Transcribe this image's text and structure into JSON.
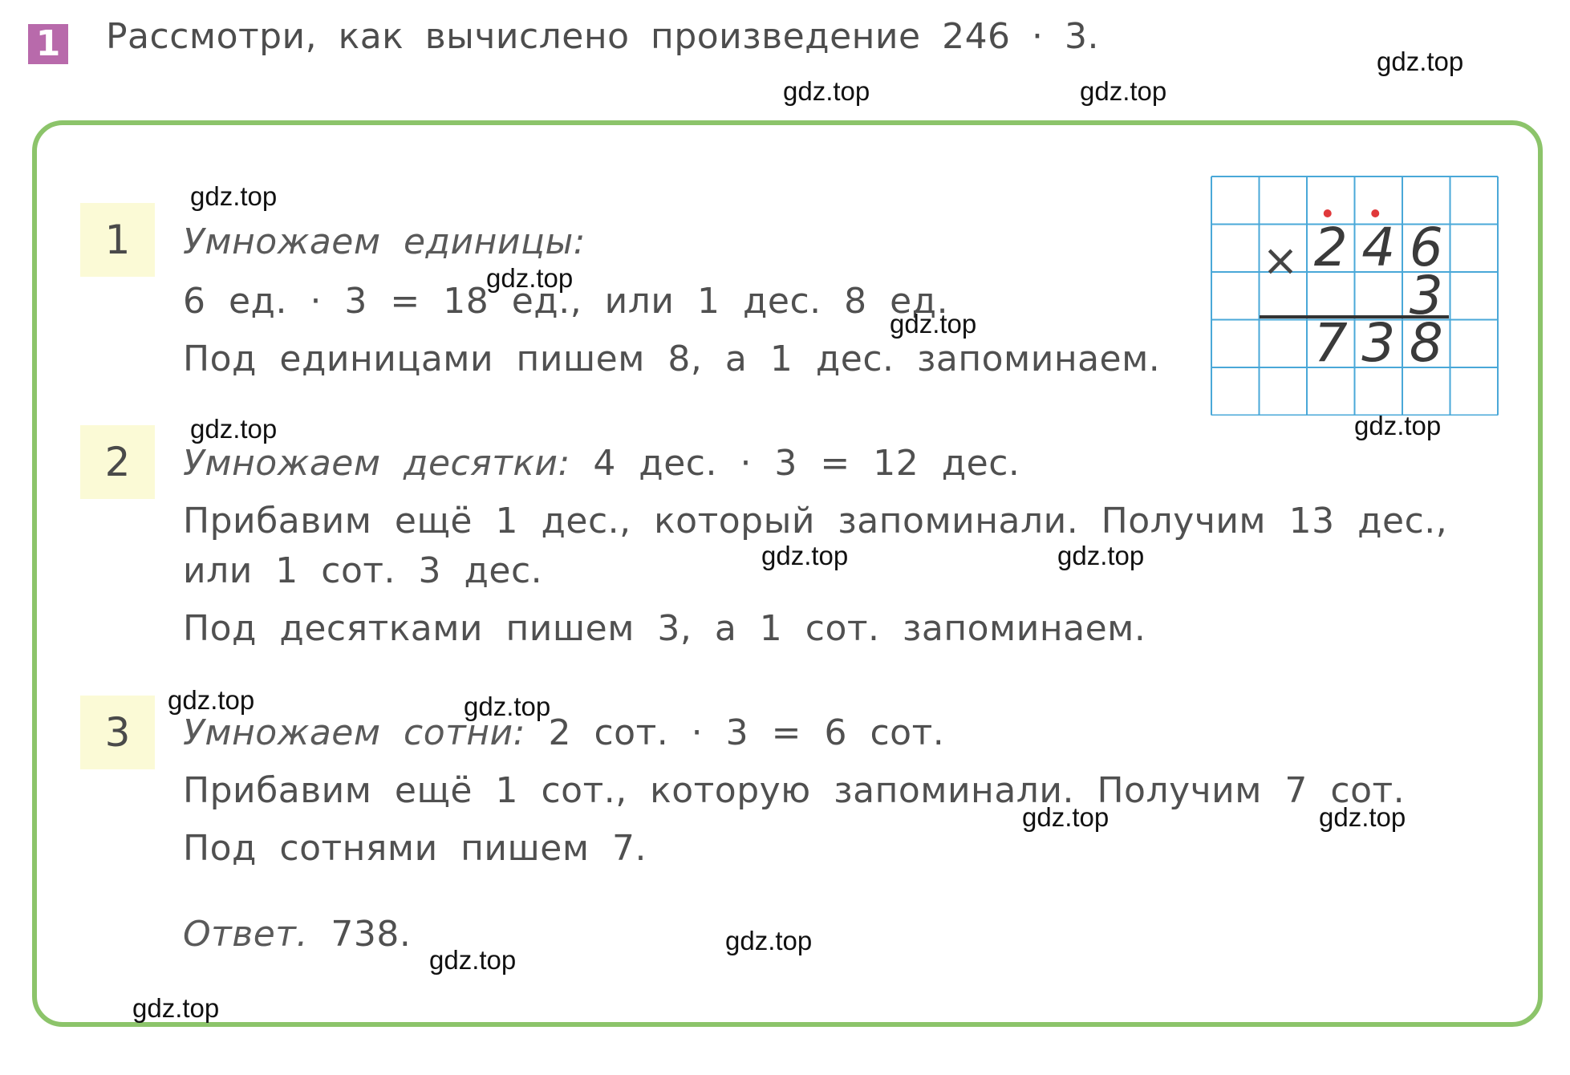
{
  "header": {
    "task_number": "1",
    "title": "Рассмотри, как вычислено произведение 246 · 3."
  },
  "steps": [
    {
      "number": "1",
      "heading": "Умножаем единицы:",
      "heading_rest": "",
      "lines": [
        "6 ед. · 3 = 18 ед., или 1 дес. 8 ед.",
        "Под единицами пишем 8, а 1 дес. запоминаем."
      ]
    },
    {
      "number": "2",
      "heading": "Умножаем десятки:",
      "heading_rest": " 4 дес. · 3 = 12 дес.",
      "lines": [
        "Прибавим ещё 1 дес., который запоминали. Получим 13 дес.,",
        "или 1 сот. 3 дес.",
        "Под десятками пишем 3, а 1 сот. запоминаем."
      ]
    },
    {
      "number": "3",
      "heading": "Умножаем сотни:",
      "heading_rest": " 2 сот. · 3 = 6 сот.",
      "lines": [
        "Прибавим ещё 1 сот., которую запоминали. Получим 7 сот.",
        "Под сотнями пишем 7."
      ]
    }
  ],
  "answer": {
    "label": "Ответ.",
    "value": " 738."
  },
  "column_multiplication": {
    "operator": "×",
    "multiplicand_digits": [
      "2",
      "4",
      "6"
    ],
    "multiplier_digits": [
      "3"
    ],
    "result_digits": [
      "7",
      "3",
      "8"
    ],
    "carry_marks_over": [
      "2",
      "4"
    ],
    "grid_color": "#4aa8d8",
    "carry_color": "#e0393b"
  },
  "watermark": "gdz.top",
  "colors": {
    "task_badge": "#b86aab",
    "frame_border": "#8cc46a",
    "step_badge_bg": "#fbfad6"
  }
}
